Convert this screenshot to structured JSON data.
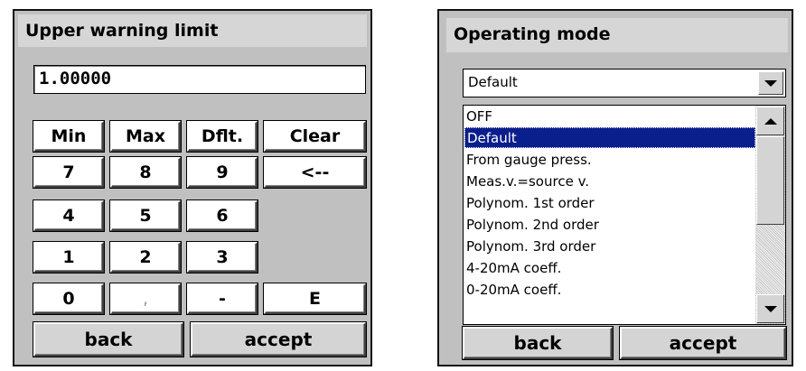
{
  "left_panel": {
    "title": "Upper warning limit",
    "input_value": "1.00000",
    "keys": {
      "min": "Min",
      "max": "Max",
      "dflt": "Dflt.",
      "clear": "Clear",
      "k7": "7",
      "k8": "8",
      "k9": "9",
      "backspace": "<--",
      "k4": "4",
      "k5": "5",
      "k6": "6",
      "k1": "1",
      "k2": "2",
      "k3": "3",
      "k0": "0",
      "comma": ",",
      "minus": "-",
      "exp": "E"
    },
    "back_label": "back",
    "accept_label": "accept"
  },
  "right_panel": {
    "title": "Operating mode",
    "selected_value": "Default",
    "options": [
      "OFF",
      "Default",
      "From gauge press.",
      "Meas.v.=source v.",
      "Polynom. 1st order",
      "Polynom. 2nd order",
      "Polynom. 3rd order",
      "4-20mA coeff.",
      "0-20mA coeff."
    ],
    "highlighted_index": 1,
    "back_label": "back",
    "accept_label": "accept"
  },
  "colors": {
    "panel_bg": "#c0c0c0",
    "selection": "#0a1e8c"
  }
}
